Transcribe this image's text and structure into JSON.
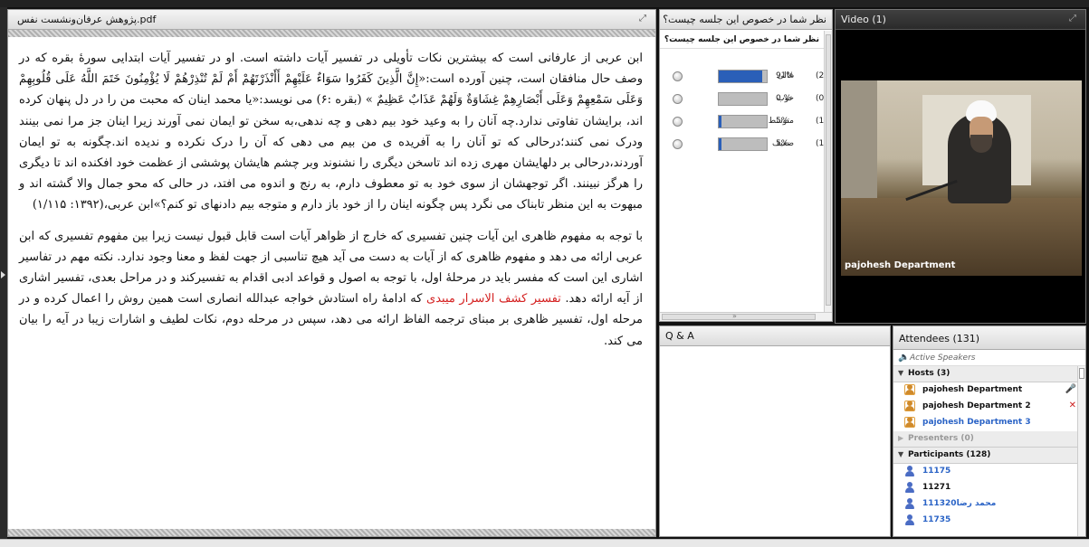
{
  "document_pod": {
    "title": "پژوهش عرفان‌ونشست نفس.pdf",
    "paragraphs": [
      "ابن عربی از عارفانی است که بیشترین نکات تأویلی در تفسیر آیات داشته است. او در تفسیر آیات ابتدایی سورهٔ بقره که در وصف حال منافقان است، چنین آورده است:«إِنَّ الَّذِينَ كَفَرُوا سَوَاءٌ عَلَيْهِمْ أَأَنْذَرْتَهُمْ أَمْ لَمْ تُنْذِرْهُمْ لَا يُؤْمِنُونَ خَتَمَ اللَّهُ عَلَى قُلُوبِهِمْ وَعَلَى سَمْعِهِمْ وَعَلَى أَبْصَارِهِمْ غِشَاوَةٌ وَلَهُمْ عَذَابٌ عَظِيمٌ » (بقره :۶) می نویسد:«یا محمد اینان که محبت من را در دل پنهان کرده اند، برایشان تفاوتی ندارد.چه آنان را به وعید خود بیم دهی و چه ندهی،به سخن تو ایمان نمی آورند زیرا اینان جز مرا نمی بینند ودرک نمی کنند؛درحالی که تو آنان را به آفریده ی من بیم می دهی که آن را درک نکرده و ندیده اند.چگونه به تو ایمان آوردند،درحالی بر دلهایشان مهری زده اند تاسخن دیگری را نشنوند وبر چشم هایشان پوششی از عظمت خود افکنده اند تا دیگری را هرگز نبینند. اگر توجهشان از سوی خود به تو معطوف دارم، به رنج و اندوه می افتد، در حالی که محو جمال والا گشته اند و مبهوت به این منظر تابناک می نگرد پس چگونه اینان را از خود باز دارم و متوجه بیم دادنهای تو کنم؟»ابن عربی،(۱۳۹۲: ۱/۱۱۵)"
    ],
    "p2_before": "با توجه به مفهوم ظاهری این آیات چنین تفسیری که خارج از ظواهر آیات است قابل قبول نیست زیرا بین مفهوم تفسیری که ابن عربی ارائه می دهد و مفهوم ظاهری که از آیات به دست می آید هیچ تناسبی از جهت لفظ و معنا وجود ندارد. نکته مهم در تفاسیر اشاری این است که مفسر باید در مرحلهٔ اول، با توجه به اصول و قواعد ادبی اقدام به تفسیرکند و در مراحل بعدی، تفسیر اشاری از آیه ارائه دهد. ",
    "p2_red": "تفسیر کشف الاسرار میبدی",
    "p2_after": " که ادامهٔ راه استادش خواجه عبدالله انصاری است همین روش را اعمال کرده و در مرحله اول، تفسیر ظاهری بر مبنای ترجمه الفاظ ارائه می دهد، سپس در مرحله دوم، نکات لطیف و اشارات زیبا در آیه را بیان می کند."
  },
  "poll_pod": {
    "title": "نظر شما در خصوص این جلسه چیست؟",
    "question": "نظر شما در خصوص این جلسه چیست؟",
    "options": [
      {
        "label": "عالی",
        "percent": 91,
        "percent_text": "91%",
        "count_text": "(20"
      },
      {
        "label": "خوب",
        "percent": 0,
        "percent_text": "0.%",
        "count_text": "(0"
      },
      {
        "label": "متوسط",
        "percent": 5,
        "percent_text": "5%",
        "count_text": "(1"
      },
      {
        "label": "ضعیف",
        "percent": 5,
        "percent_text": "5%",
        "count_text": "(1"
      }
    ],
    "bar_color": "#2a5fb8"
  },
  "video_pod": {
    "title": "Video",
    "count": "(1)",
    "caption": "pajohesh Department"
  },
  "qa_pod": {
    "title": "Q & A"
  },
  "attendees_pod": {
    "title": "Attendees",
    "count": "(131)",
    "active_speakers": "Active Speakers",
    "hosts_label": "Hosts (3)",
    "hosts": [
      {
        "name": "pajohesh Department",
        "highlight": false,
        "status_icon": "microphone-icon"
      },
      {
        "name": "pajohesh Department 2",
        "highlight": false,
        "status_icon": "no-video-icon"
      },
      {
        "name": "pajohesh Department 3",
        "highlight": true,
        "status_icon": ""
      }
    ],
    "presenters_label": "Presenters (0)",
    "participants_label": "Participants (128)",
    "participants": [
      {
        "name": "11175",
        "highlight": true
      },
      {
        "name": "11271",
        "highlight": false
      },
      {
        "name": "111320محمد رضا",
        "highlight": true
      },
      {
        "name": "11735",
        "highlight": true
      }
    ]
  }
}
